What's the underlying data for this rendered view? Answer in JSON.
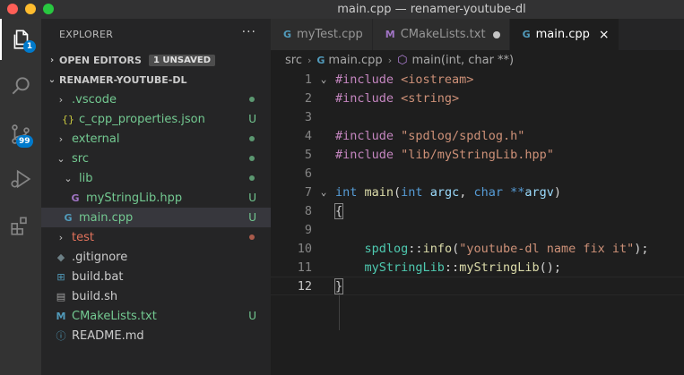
{
  "window": {
    "title": "main.cpp — renamer-youtube-dl"
  },
  "activity": {
    "explorer_badge": "1",
    "scm_badge": "99"
  },
  "sidebar": {
    "header": "EXPLORER",
    "more": "···",
    "open_editors": {
      "label": "OPEN EDITORS",
      "badge": "1 UNSAVED"
    },
    "project": {
      "label": "RENAMER-YOUTUBE-DL"
    },
    "items": [
      {
        "label": ".vscode",
        "icon": "›"
      },
      {
        "label": "c_cpp_properties.json",
        "icon": "{}",
        "status": "U"
      },
      {
        "label": "external",
        "icon": "›"
      },
      {
        "label": "src",
        "icon": "⌄"
      },
      {
        "label": "lib",
        "icon": "⌄"
      },
      {
        "label": "myStringLib.hpp",
        "icon": "G",
        "status": "U"
      },
      {
        "label": "main.cpp",
        "icon": "G",
        "status": "U"
      },
      {
        "label": "test",
        "icon": "›"
      },
      {
        "label": ".gitignore",
        "icon": "◆"
      },
      {
        "label": "build.bat",
        "icon": "⊞"
      },
      {
        "label": "build.sh",
        "icon": "▤"
      },
      {
        "label": "CMakeLists.txt",
        "icon": "M",
        "status": "U"
      },
      {
        "label": "README.md",
        "icon": "ⓘ"
      }
    ]
  },
  "tabs": [
    {
      "label": "myTest.cpp",
      "icon": "G"
    },
    {
      "label": "CMakeLists.txt",
      "icon": "M"
    },
    {
      "label": "main.cpp",
      "icon": "G",
      "close": "×"
    }
  ],
  "breadcrumb": {
    "folder": "src",
    "file": "main.cpp",
    "symbol": "main(int, char **)"
  },
  "code": {
    "line_numbers": [
      "1",
      "2",
      "3",
      "4",
      "5",
      "6",
      "7",
      "8",
      "9",
      "10",
      "11",
      "12"
    ],
    "l1": {
      "a": "#include",
      "b": " <iostream>"
    },
    "l2": {
      "a": "#include",
      "b": " <string>"
    },
    "l4": {
      "a": "#include",
      "b": " \"spdlog/spdlog.h\""
    },
    "l5": {
      "a": "#include",
      "b": " \"lib/myStringLib.hpp\""
    },
    "l7": {
      "kw1": "int",
      "fn": " main",
      "p1": "(",
      "kw2": "int",
      "v1": " argc",
      "c": ", ",
      "kw3": "char",
      "op": " **",
      "v2": "argv",
      "p2": ")"
    },
    "l8": "{",
    "l10": {
      "ns": "spdlog",
      "sep": "::",
      "fn": "info",
      "p1": "(",
      "str": "\"youtube-dl name fix it\"",
      "p2": ");"
    },
    "l11": {
      "ns": "myStringLib",
      "sep": "::",
      "fn": "myStringLib",
      "p": "();"
    },
    "l12": "}"
  }
}
